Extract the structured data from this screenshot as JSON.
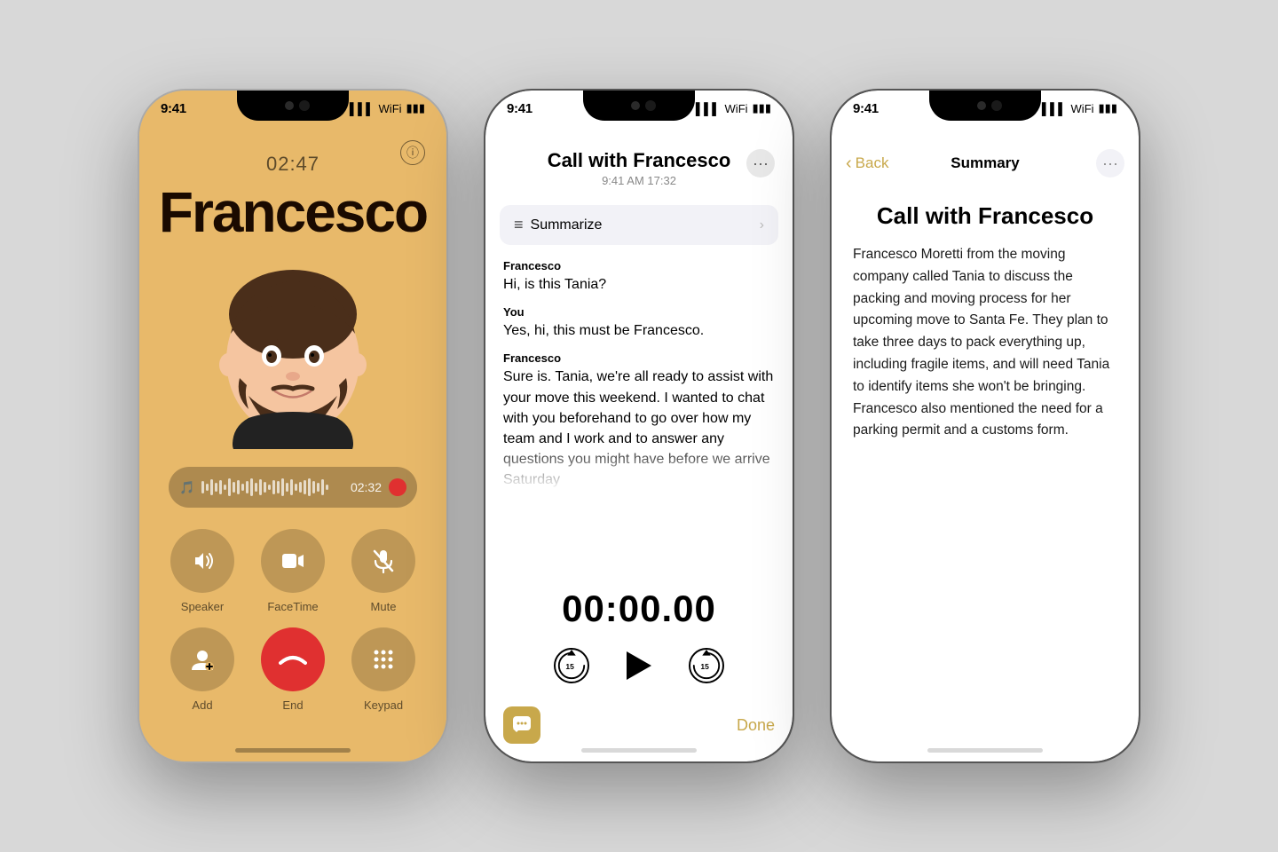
{
  "background": "#d8d8d8",
  "phone1": {
    "status": {
      "time": "9:41",
      "signal": "▌▌▌",
      "wifi": "⌘",
      "battery": "▮▮▮▮"
    },
    "callTimer": "02:47",
    "callerName": "Francesco",
    "infoIcon": "ⓘ",
    "recordingTime": "02:32",
    "buttons": {
      "row1": [
        {
          "label": "Speaker",
          "icon": "🔊"
        },
        {
          "label": "FaceTime",
          "icon": "📹"
        },
        {
          "label": "Mute",
          "icon": "🎤"
        }
      ],
      "row2": [
        {
          "label": "Add",
          "icon": "👤"
        },
        {
          "label": "End",
          "icon": "✕",
          "end": true
        },
        {
          "label": "Keypad",
          "icon": "⠿"
        }
      ]
    }
  },
  "phone2": {
    "status": {
      "time": "9:41",
      "signal": "▌▌▌",
      "wifi": "⌘",
      "battery": "▮▮▮▮"
    },
    "title": "Call with Francesco",
    "subtitle": "9:41 AM  17:32",
    "moreIcon": "•••",
    "summarizeLabel": "Summarize",
    "messages": [
      {
        "sender": "Francesco",
        "text": "Hi, is this Tania?"
      },
      {
        "sender": "You",
        "text": "Yes, hi, this must be Francesco."
      },
      {
        "sender": "Francesco",
        "text": "Sure is. Tania, we're all ready to assist with your move this weekend. I wanted to chat with you beforehand to go over how my team and I work and to answer any questions you might have before we arrive Saturday",
        "fade": true
      }
    ],
    "playbackTime": "00:00.00",
    "doneLabel": "Done"
  },
  "phone3": {
    "status": {
      "time": "9:41",
      "signal": "▌▌▌",
      "wifi": "⌘",
      "battery": "▮▮▮▮"
    },
    "navTitle": "Summary",
    "backLabel": "Back",
    "moreIcon": "•••",
    "title": "Call with Francesco",
    "summary": "Francesco Moretti from the moving company called Tania to discuss the packing and moving process for her upcoming move to Santa Fe. They plan to take three days to pack everything up, including fragile items, and will need Tania to identify items she won't be bringing. Francesco also mentioned the need for a parking permit and a customs form."
  }
}
